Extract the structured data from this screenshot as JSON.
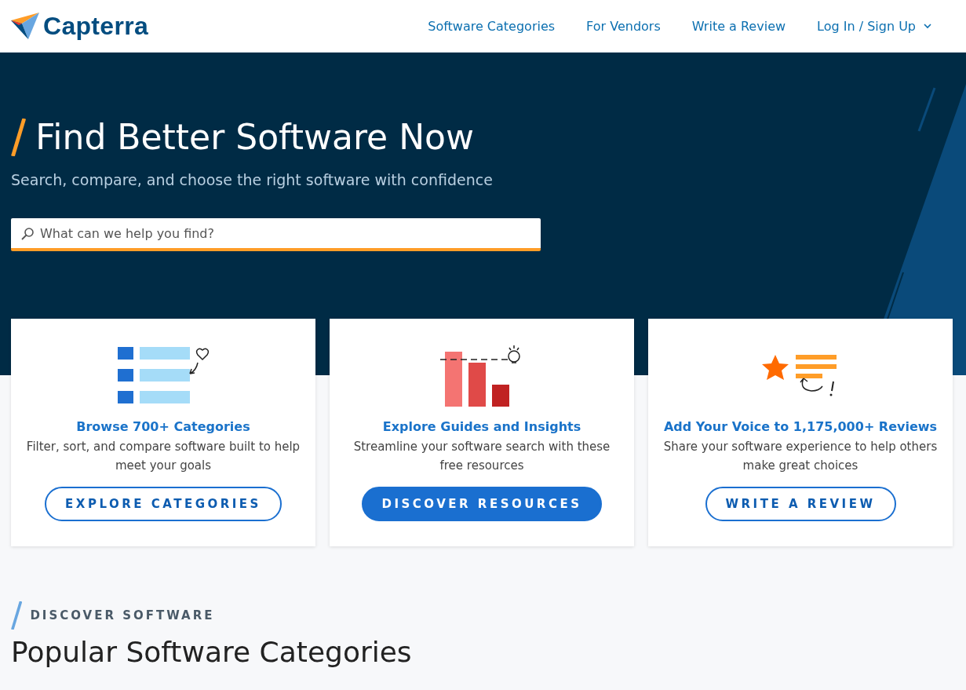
{
  "header": {
    "logo": "Capterra",
    "nav": [
      {
        "label": "Software Categories",
        "has_menu": false
      },
      {
        "label": "For Vendors",
        "has_menu": false
      },
      {
        "label": "Write a Review",
        "has_menu": false
      },
      {
        "label": "Log In / Sign Up",
        "has_menu": true
      }
    ]
  },
  "hero": {
    "title": "Find Better Software Now",
    "subtitle": "Search, compare, and choose the right software with confidence",
    "search": {
      "placeholder": "What can we help you find?"
    }
  },
  "cards": [
    {
      "kind": "categories",
      "title": "Browse 700+ Categories",
      "text": "Filter, sort, and compare software built to help meet your goals",
      "button": {
        "label": "EXPLORE CATEGORIES",
        "kind": "outline"
      }
    },
    {
      "kind": "guides",
      "title": "Explore Guides and Insights",
      "text": "Streamline your software search with these free resources",
      "button": {
        "label": "DISCOVER RESOURCES",
        "kind": "filled"
      }
    },
    {
      "kind": "reviews",
      "title": "Add Your Voice to 1,175,000+ Reviews",
      "text": "Share your software experience to help others make great choices",
      "button": {
        "label": "WRITE A REVIEW",
        "kind": "outline"
      }
    }
  ],
  "section": {
    "eyebrow": "DISCOVER SOFTWARE",
    "heading": "Popular Software Categories"
  }
}
